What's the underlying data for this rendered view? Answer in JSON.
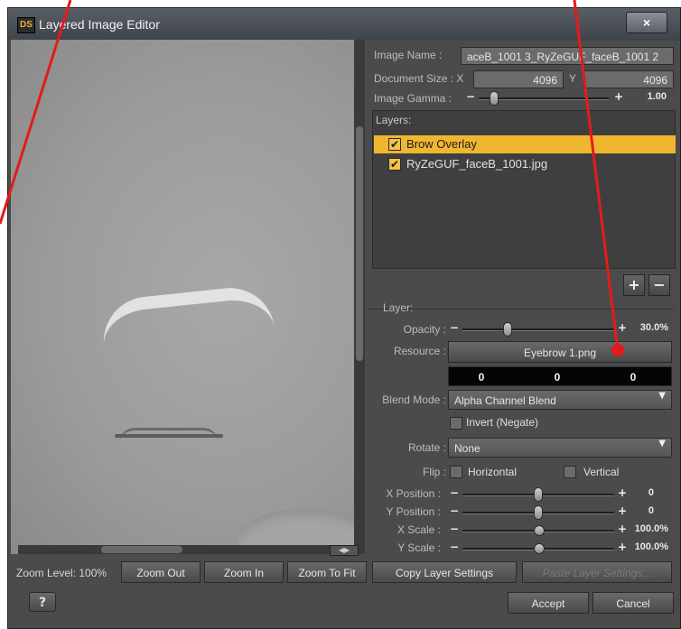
{
  "window": {
    "title": "Layered Image Editor",
    "logo": "DS",
    "close_glyph": "×"
  },
  "image": {
    "name_label": "Image Name :",
    "name_value": "aceB_1001 3_RyZeGUF_faceB_1001 2",
    "doc_size_label": "Document Size : X",
    "doc_size_x": "4096",
    "doc_size_y_label": "Y",
    "doc_size_y": "4096",
    "gamma_label": "Image Gamma :",
    "gamma_value": "1.00",
    "gamma_level": 0.12
  },
  "layers": {
    "header": "Layers:",
    "items": [
      {
        "label": "Brow Overlay",
        "checked": true,
        "selected": true
      },
      {
        "label": "RyZeGUF_faceB_1001.jpg",
        "checked": true,
        "selected": false
      }
    ],
    "add_glyph": "+",
    "remove_glyph": "−"
  },
  "layer": {
    "section_label": "Layer:",
    "opacity_label": "Opacity :",
    "opacity_value": "30.0%",
    "opacity_level": 0.3,
    "resource_label": "Resource :",
    "resource_value": "Eyebrow 1.png",
    "rgb": [
      "0",
      "0",
      "0"
    ],
    "blend_label": "Blend Mode :",
    "blend_value": "Alpha Channel Blend",
    "invert_label": "Invert (Negate)",
    "rotate_label": "Rotate :",
    "rotate_value": "None",
    "flip_label": "Flip :",
    "flip_h_label": "Horizontal",
    "flip_v_label": "Vertical",
    "x_pos_label": "X Position :",
    "x_pos_value": "0",
    "y_pos_label": "Y Position :",
    "y_pos_value": "0",
    "x_scale_label": "X Scale :",
    "x_scale_value": "100.0%",
    "y_scale_label": "Y Scale :",
    "y_scale_value": "100.0%",
    "copy_label": "Copy Layer Settings",
    "paste_label": "Paste Layer Settings..."
  },
  "viewer": {
    "zoom_label": "Zoom Level: 100%",
    "zoom_out": "Zoom Out",
    "zoom_in": "Zoom In",
    "zoom_fit": "Zoom To Fit"
  },
  "footer": {
    "help_glyph": "?",
    "accept": "Accept",
    "cancel": "Cancel"
  },
  "colors": {
    "selection": "#f0b630",
    "annotation": "#e31b1b"
  }
}
